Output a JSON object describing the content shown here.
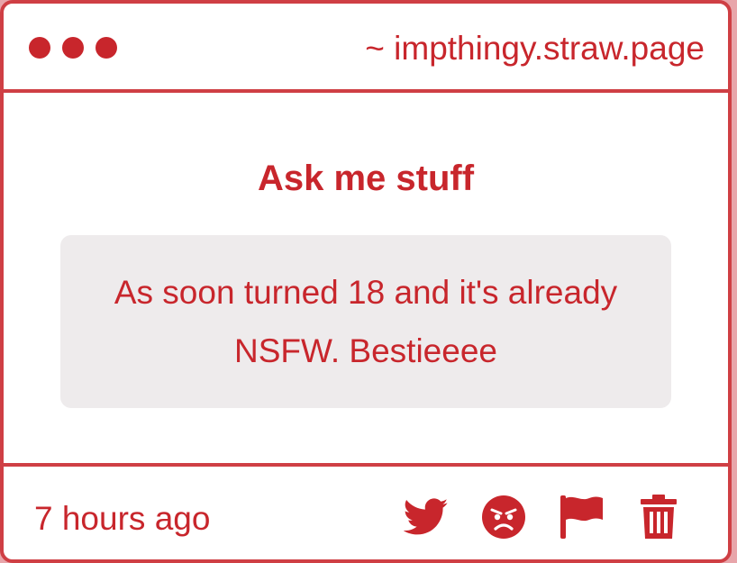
{
  "header": {
    "domain": "~ impthingy.straw.page"
  },
  "main": {
    "title": "Ask me stuff",
    "message": "As soon turned 18 and it's already NSFW. Bestieeee"
  },
  "footer": {
    "timestamp": "7 hours ago",
    "actions": [
      {
        "icon": "twitter-icon"
      },
      {
        "icon": "angry-face-icon"
      },
      {
        "icon": "flag-icon"
      },
      {
        "icon": "trash-icon"
      }
    ]
  },
  "colors": {
    "accent": "#c8262c",
    "border": "#cf3f44",
    "bubble": "#eeebec",
    "background": "#e8a5aa"
  }
}
